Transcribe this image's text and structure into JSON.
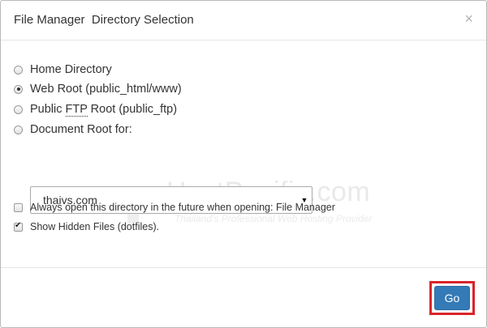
{
  "dialog": {
    "title": "File Manager  Directory Selection",
    "close_glyph": "×"
  },
  "options": {
    "home_directory": {
      "label": "Home Directory",
      "checked": false
    },
    "web_root": {
      "label": "Web Root (public_html/www)",
      "checked": true
    },
    "public_ftp": {
      "prefix": "Public ",
      "abbr": "FTP",
      "suffix": " Root (public_ftp)",
      "checked": false
    },
    "document_root": {
      "label": "Document Root for:",
      "checked": false
    }
  },
  "domain_select": {
    "value": "thaivs.com",
    "arrow_icon": "caret-down-icon"
  },
  "checkboxes": {
    "always_open": {
      "label": "Always open this directory in the future when opening: File Manager",
      "checked": false
    },
    "show_hidden": {
      "label": "Show Hidden Files (dotfiles).",
      "checked": true
    }
  },
  "watermark": {
    "brand": "HostPacific.com",
    "tagline": "Thailand's Professional Web Hosting Provider"
  },
  "footer": {
    "go_label": "Go",
    "highlight_color": "#d9242a",
    "button_color": "#337ab7"
  }
}
